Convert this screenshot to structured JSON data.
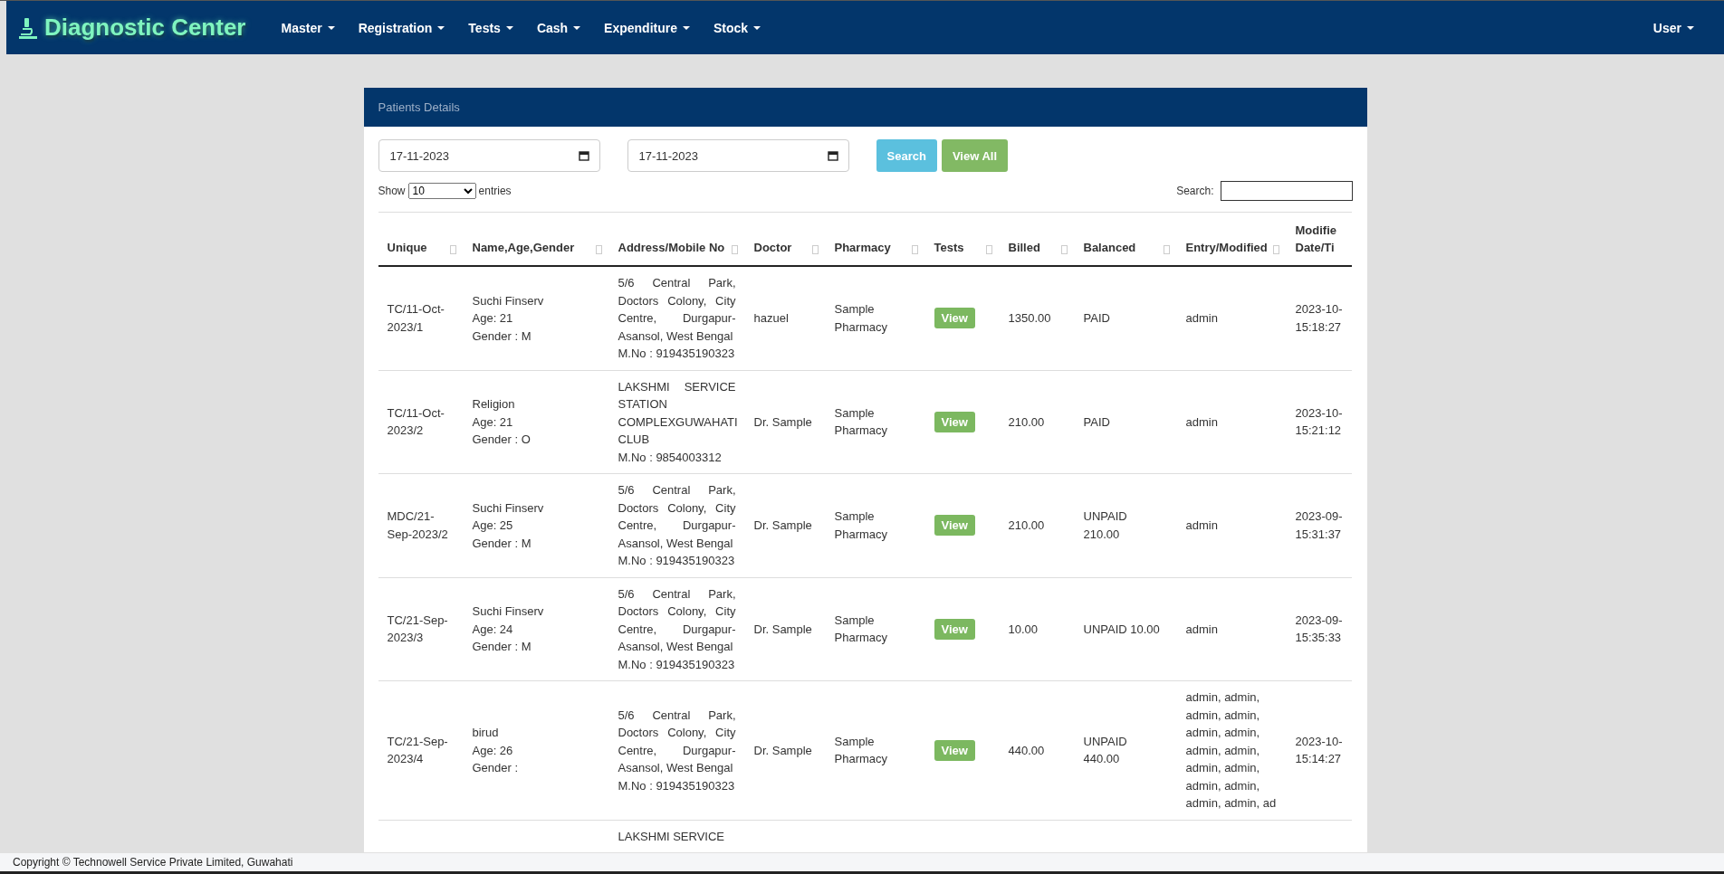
{
  "brand": {
    "title": "Diagnostic Center"
  },
  "nav": [
    {
      "label": "Master"
    },
    {
      "label": "Registration"
    },
    {
      "label": "Tests"
    },
    {
      "label": "Cash"
    },
    {
      "label": "Expenditure"
    },
    {
      "label": "Stock"
    }
  ],
  "user_menu": {
    "label": "User"
  },
  "panel": {
    "title": "Patients Details",
    "from_date": "17-11-2023",
    "to_date": "17-11-2023",
    "buttons": [
      {
        "label": "Search",
        "kind": "info"
      },
      {
        "label": "View All",
        "kind": "success"
      }
    ],
    "length": {
      "prefix": "Show",
      "value": "10",
      "suffix": "entries"
    },
    "search": {
      "label": "Search:"
    }
  },
  "table": {
    "columns": [
      "Unique",
      "Name,Age,Gender",
      "Address/Mobile No",
      "Doctor",
      "Pharmacy",
      "Tests",
      "Billed",
      "Balanced",
      "Entry/Modified",
      "Modifie Date/Ti"
    ],
    "rows": [
      {
        "unique": "TC/11-Oct-2023/1",
        "name": "Suchi Finserv",
        "age": "Age: 21",
        "gender": "Gender : M",
        "address": "5/6 Central Park, Doctors Colony, City Centre, Durgapur-Asansol, West Bengal",
        "mobile": "M.No : 919435190323",
        "doctor": "hazuel",
        "pharmacy": "Sample Pharmacy",
        "tests": "View",
        "billed": "1350.00",
        "balanced": "PAID",
        "entry": "admin",
        "modified": "2023-10- 15:18:27"
      },
      {
        "unique": "TC/11-Oct-2023/2",
        "name": "Religion",
        "age": "Age: 21",
        "gender": "Gender : O",
        "address": "LAKSHMI SERVICE STATION COMPLEXGUWAHATI CLUB",
        "mobile": "M.No : 9854003312",
        "doctor": "Dr. Sample",
        "pharmacy": "Sample Pharmacy",
        "tests": "View",
        "billed": "210.00",
        "balanced": "PAID",
        "entry": "admin",
        "modified": "2023-10- 15:21:12"
      },
      {
        "unique": "MDC/21-Sep-2023/2",
        "name": "Suchi Finserv",
        "age": "Age: 25",
        "gender": "Gender : M",
        "address": "5/6 Central Park, Doctors Colony, City Centre, Durgapur-Asansol, West Bengal",
        "mobile": "M.No : 919435190323",
        "doctor": "Dr. Sample",
        "pharmacy": "Sample Pharmacy",
        "tests": "View",
        "billed": "210.00",
        "balanced": "UNPAID 210.00",
        "entry": "admin",
        "modified": "2023-09- 15:31:37"
      },
      {
        "unique": "TC/21-Sep-2023/3",
        "name": "Suchi Finserv",
        "age": "Age: 24",
        "gender": "Gender : M",
        "address": "5/6 Central Park, Doctors Colony, City Centre, Durgapur-Asansol, West Bengal",
        "mobile": "M.No : 919435190323",
        "doctor": "Dr. Sample",
        "pharmacy": "Sample Pharmacy",
        "tests": "View",
        "billed": "10.00",
        "balanced": "UNPAID 10.00",
        "entry": "admin",
        "modified": "2023-09- 15:35:33"
      },
      {
        "unique": "TC/21-Sep-2023/4",
        "name": "birud",
        "age": "Age: 26",
        "gender": "Gender :",
        "address": "5/6 Central Park, Doctors Colony, City Centre, Durgapur-Asansol, West Bengal",
        "mobile": "M.No : 919435190323",
        "doctor": "Dr. Sample",
        "pharmacy": "Sample Pharmacy",
        "tests": "View",
        "billed": "440.00",
        "balanced": "UNPAID 440.00",
        "entry": "admin, admin, admin, admin, admin, admin, admin, admin, admin, admin, admin, admin, admin, admin, ad",
        "modified": "2023-10- 15:14:27"
      },
      {
        "address": "LAKSHMI SERVICE"
      }
    ]
  },
  "footer": {
    "text": "Copyright © Technowell Service Private Limited, Guwahati"
  }
}
